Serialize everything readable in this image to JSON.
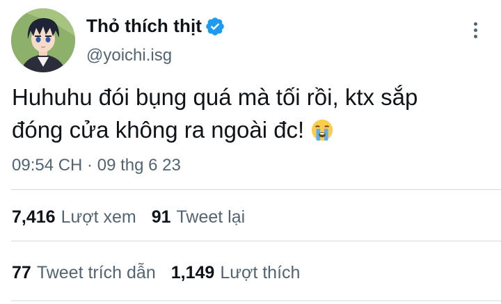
{
  "user": {
    "display_name": "Thỏ thích thịt",
    "handle": "@yoichi.isg",
    "verified_icon": "verified-badge-icon",
    "verified_color": "#1d9bf0"
  },
  "tweet": {
    "text_line1": "Huhuhu đói bụng quá mà tối rồi, ktx sắp",
    "text_line2": "đóng cửa không ra ngoài đc!",
    "emoji": "loudly-crying-face-icon",
    "timestamp": "09:54 CH · 09 thg 6 23"
  },
  "stats": {
    "views_count": "7,416",
    "views_label": "Lượt xem",
    "retweets_count": "91",
    "retweets_label": "Tweet lại",
    "quotes_count": "77",
    "quotes_label": "Tweet trích dẫn",
    "likes_count": "1,149",
    "likes_label": "Lượt thích"
  },
  "colors": {
    "text_primary": "#0f1419",
    "text_secondary": "#536471",
    "divider": "#cfd9de"
  }
}
